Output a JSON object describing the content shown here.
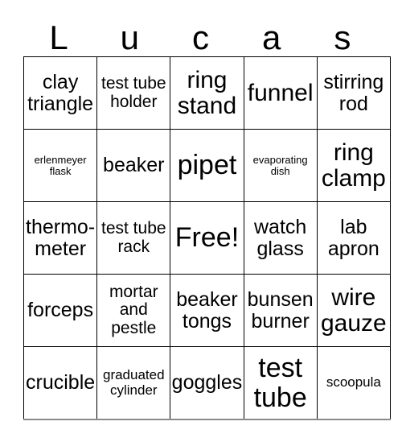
{
  "card": {
    "header_letters": [
      "L",
      "u",
      "c",
      "a",
      "s"
    ],
    "free_space_label": "Free!",
    "colors": {
      "background": "#ffffff",
      "text": "#000000",
      "grid_line": "#000000",
      "outer_edge": "#8a8a8a"
    },
    "grid": {
      "columns": 5,
      "rows": 5,
      "cells": [
        [
          {
            "label": "clay triangle",
            "size": "l"
          },
          {
            "label": "test tube holder",
            "size": "m"
          },
          {
            "label": "ring stand",
            "size": "xl"
          },
          {
            "label": "funnel",
            "size": "xl"
          },
          {
            "label": "stirring rod",
            "size": "l"
          }
        ],
        [
          {
            "label": "erlenmeyer flask",
            "size": "xs"
          },
          {
            "label": "beaker",
            "size": "l"
          },
          {
            "label": "pipet",
            "size": "xxl"
          },
          {
            "label": "evaporating dish",
            "size": "xs"
          },
          {
            "label": "ring clamp",
            "size": "xl"
          }
        ],
        [
          {
            "label": "thermo-meter",
            "size": "l"
          },
          {
            "label": "test tube rack",
            "size": "m"
          },
          {
            "label": "Free!",
            "size": "xxl"
          },
          {
            "label": "watch glass",
            "size": "l"
          },
          {
            "label": "lab apron",
            "size": "l"
          }
        ],
        [
          {
            "label": "forceps",
            "size": "l"
          },
          {
            "label": "mortar and pestle",
            "size": "m"
          },
          {
            "label": "beaker tongs",
            "size": "l"
          },
          {
            "label": "bunsen burner",
            "size": "l"
          },
          {
            "label": "wire gauze",
            "size": "xl"
          }
        ],
        [
          {
            "label": "crucible",
            "size": "l"
          },
          {
            "label": "graduated cylinder",
            "size": "s"
          },
          {
            "label": "goggles",
            "size": "l"
          },
          {
            "label": "test tube",
            "size": "xxl"
          },
          {
            "label": "scoopula",
            "size": "s"
          }
        ]
      ]
    }
  }
}
